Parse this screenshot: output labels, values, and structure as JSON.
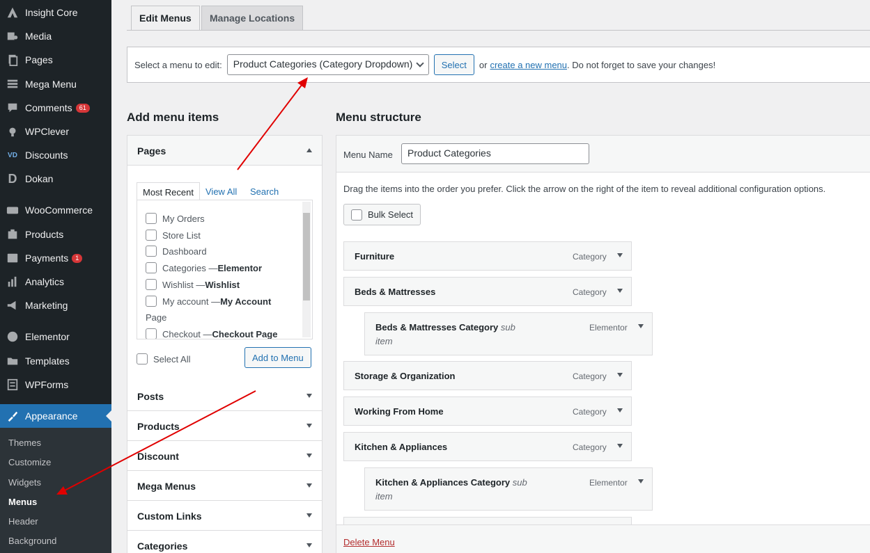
{
  "sidebar": {
    "items": [
      {
        "label": "Insight Core",
        "icon": "insight-core-icon"
      },
      {
        "label": "Media",
        "icon": "media-icon"
      },
      {
        "label": "Pages",
        "icon": "pages-icon"
      },
      {
        "label": "Mega Menu",
        "icon": "mega-menu-icon"
      },
      {
        "label": "Comments",
        "icon": "comments-icon",
        "badge": "61"
      },
      {
        "label": "WPClever",
        "icon": "wpclever-icon"
      },
      {
        "label": "Discounts",
        "icon": "discounts-icon"
      },
      {
        "label": "Dokan",
        "icon": "dokan-icon"
      },
      {
        "label": "WooCommerce",
        "icon": "woocommerce-icon"
      },
      {
        "label": "Products",
        "icon": "products-icon"
      },
      {
        "label": "Payments",
        "icon": "payments-icon",
        "badge": "1"
      },
      {
        "label": "Analytics",
        "icon": "analytics-icon"
      },
      {
        "label": "Marketing",
        "icon": "marketing-icon"
      },
      {
        "label": "Elementor",
        "icon": "elementor-icon"
      },
      {
        "label": "Templates",
        "icon": "templates-icon"
      },
      {
        "label": "WPForms",
        "icon": "wpforms-icon"
      },
      {
        "label": "Appearance",
        "icon": "appearance-icon",
        "active": true
      }
    ],
    "submenu": [
      "Themes",
      "Customize",
      "Widgets",
      "Menus",
      "Header",
      "Background"
    ],
    "current_submenu": "Menus"
  },
  "tabs": {
    "edit": "Edit Menus",
    "manage": "Manage Locations"
  },
  "manage_bar": {
    "label": "Select a menu to edit:",
    "selected_menu": "Product Categories (Category Dropdown)",
    "select_button": "Select",
    "or_text": "or",
    "create_link": "create a new menu",
    "reminder": ". Do not forget to save your changes!"
  },
  "add_items": {
    "heading": "Add menu items",
    "pages_title": "Pages",
    "inner_tabs": [
      "Most Recent",
      "View All",
      "Search"
    ],
    "pages": [
      {
        "label": "My Orders",
        "suffix": ""
      },
      {
        "label": "Store List",
        "suffix": ""
      },
      {
        "label": "Dashboard",
        "suffix": ""
      },
      {
        "label": "Categories — ",
        "suffix": "Elementor"
      },
      {
        "label": "Wishlist — ",
        "suffix": "Wishlist"
      },
      {
        "label": "My account — ",
        "suffix": "My Account"
      },
      {
        "label": "Page",
        "suffix": "",
        "plain": true
      },
      {
        "label": "Checkout — ",
        "suffix": "Checkout Page"
      }
    ],
    "select_all": "Select All",
    "add_button": "Add to Menu",
    "sections": [
      "Posts",
      "Products",
      "Discount",
      "Mega Menus",
      "Custom Links",
      "Categories"
    ]
  },
  "structure": {
    "heading": "Menu structure",
    "menu_name_label": "Menu Name",
    "menu_name_value": "Product Categories",
    "instructions": "Drag the items into the order you prefer. Click the arrow on the right of the item to reveal additional configuration options.",
    "bulk_select": "Bulk Select",
    "items": [
      {
        "title": "Furniture",
        "type": "Category",
        "sub": false
      },
      {
        "title": "Beds & Mattresses",
        "type": "Category",
        "sub": false
      },
      {
        "title": "Beds & Mattresses Category",
        "type": "Elementor",
        "sub": true,
        "note1": "sub",
        "note2": "item"
      },
      {
        "title": "Storage & Organization",
        "type": "Category",
        "sub": false
      },
      {
        "title": "Working From Home",
        "type": "Category",
        "sub": false
      },
      {
        "title": "Kitchen & Appliances",
        "type": "Category",
        "sub": false
      },
      {
        "title": "Kitchen & Appliances Category",
        "type": "Elementor",
        "sub": true,
        "note1": "sub",
        "note2": "item"
      }
    ],
    "delete_menu": "Delete Menu"
  }
}
